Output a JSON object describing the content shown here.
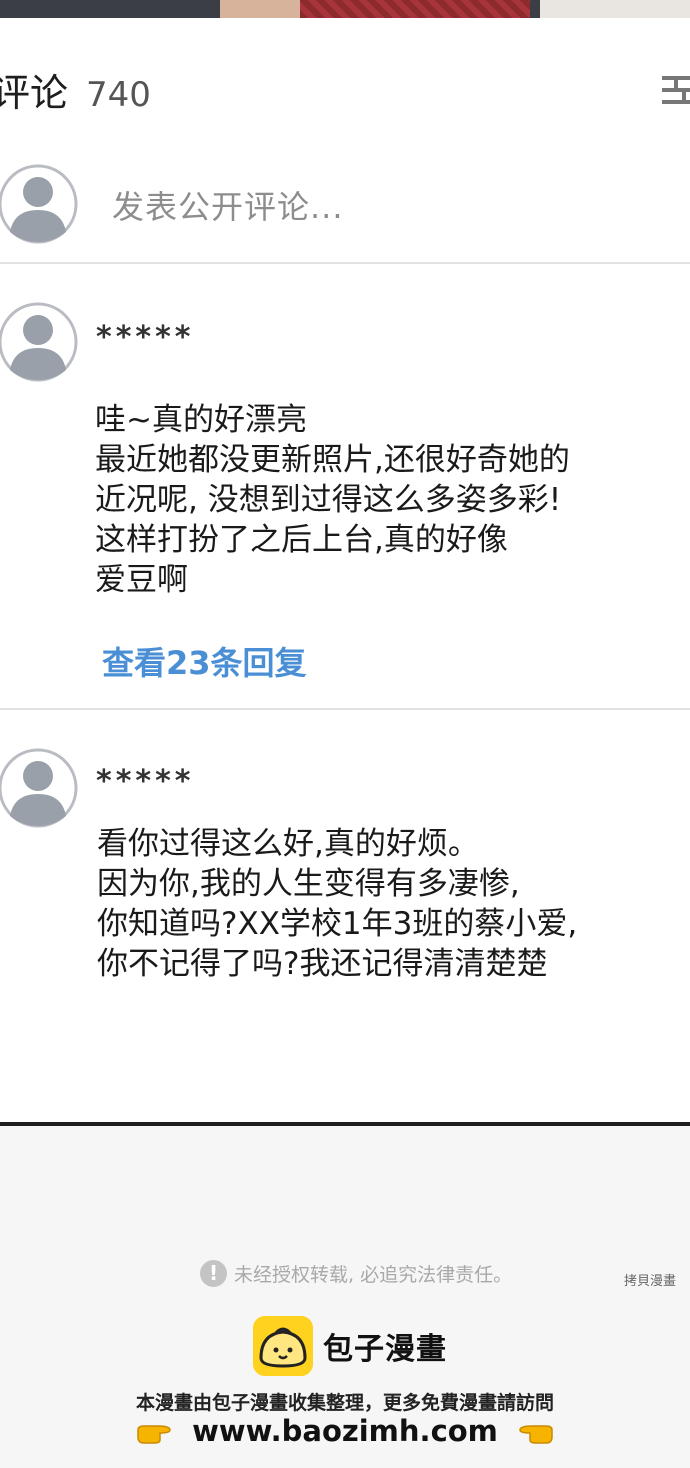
{
  "comments": {
    "title": "评论",
    "count": "740",
    "compose_placeholder": "发表公开评论..."
  },
  "comment_list": [
    {
      "author": "*****",
      "lines": [
        "哇~真的好漂亮",
        "最近她都没更新照片,还很好奇她的",
        "近况呢, 没想到过得这么多姿多彩!",
        "这样打扮了之后上台,真的好像",
        "爱豆啊"
      ],
      "replies_label": "查看23条回复"
    },
    {
      "author": "*****",
      "lines": [
        "看你过得这么好,真的好烦。",
        "因为你,我的人生变得有多凄惨,",
        "你知道吗?XX学校1年3班的蔡小爱,",
        "你不记得了吗?我还记得清清楚楚"
      ]
    }
  ],
  "footer": {
    "notice": "未经授权转载, 必追究法律责任。",
    "watermark": "拷貝漫畫",
    "brand": "包子漫畫",
    "tagline": "本漫畫由包子漫畫收集整理，更多免費漫畫請訪問",
    "url": "www.baozimh.com"
  },
  "icons": {
    "sort": "sort-icon",
    "avatar": "default-avatar-icon",
    "notice": "exclamation-icon",
    "brand_logo": "bun-logo-icon",
    "pointing_hand": "pointing-hand-icon"
  },
  "colors": {
    "link": "#4a8fd6",
    "brand_yellow": "#ffd21f"
  }
}
